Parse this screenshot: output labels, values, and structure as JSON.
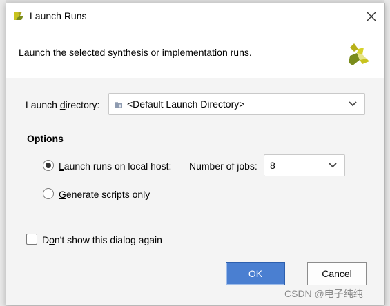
{
  "window": {
    "title": "Launch Runs"
  },
  "header": {
    "description": "Launch the selected synthesis or implementation runs."
  },
  "launch_directory": {
    "label_pre": "Launch ",
    "label_mnemonic": "d",
    "label_post": "irectory:",
    "value": "<Default Launch Directory>"
  },
  "options": {
    "title": "Options",
    "local_host": {
      "label_pre": "",
      "label_mnemonic": "L",
      "label_post": "aunch runs on local host:",
      "selected": true
    },
    "jobs": {
      "label": "Number of jobs:",
      "value": "8"
    },
    "scripts_only": {
      "label_pre": "",
      "label_mnemonic": "G",
      "label_post": "enerate scripts only",
      "selected": false
    }
  },
  "dont_show": {
    "label_pre": "D",
    "label_mnemonic": "o",
    "label_post": "n't show this dialog again",
    "checked": false
  },
  "buttons": {
    "ok": "OK",
    "cancel": "Cancel"
  },
  "watermark": "CSDN @电子纯纯",
  "colors": {
    "ok_button": "#4a7fd1",
    "logo_yellow": "#c8c31e",
    "logo_green": "#7a8c1c"
  }
}
